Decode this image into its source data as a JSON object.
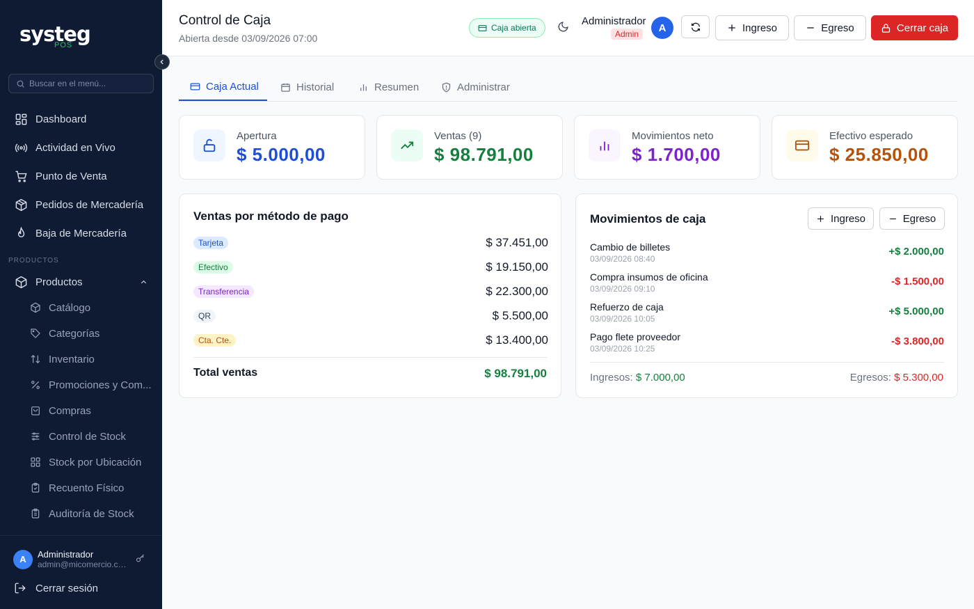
{
  "brand": {
    "name": "systeg",
    "sub": "POS"
  },
  "sidebar": {
    "search_placeholder": "Buscar en el menú...",
    "items": [
      {
        "label": "Dashboard",
        "icon": "dashboard-icon"
      },
      {
        "label": "Actividad en Vivo",
        "icon": "broadcast-icon"
      },
      {
        "label": "Punto de Venta",
        "icon": "cart-icon"
      },
      {
        "label": "Pedidos de Mercadería",
        "icon": "package-icon"
      },
      {
        "label": "Baja de Mercadería",
        "icon": "flame-icon"
      }
    ],
    "section_label": "PRODUCTOS",
    "group": {
      "label": "Productos",
      "icon": "box-icon"
    },
    "subitems": [
      {
        "label": "Catálogo",
        "icon": "box-icon"
      },
      {
        "label": "Categorías",
        "icon": "tag-icon"
      },
      {
        "label": "Inventario",
        "icon": "sort-icon"
      },
      {
        "label": "Promociones y Com...",
        "icon": "percent-icon"
      },
      {
        "label": "Compras",
        "icon": "bag-icon"
      },
      {
        "label": "Control de Stock",
        "icon": "sliders-icon"
      },
      {
        "label": "Stock por Ubicación",
        "icon": "grid-icon"
      },
      {
        "label": "Recuento Físico",
        "icon": "clipboard-icon"
      },
      {
        "label": "Auditoría de Stock",
        "icon": "clipboard-list-icon"
      }
    ],
    "user": {
      "initial": "A",
      "name": "Administrador",
      "email": "admin@micomercio.com"
    },
    "logout_label": "Cerrar sesión"
  },
  "header": {
    "title": "Control de Caja",
    "subtitle": "Abierta desde 03/09/2026 07:00",
    "status_badge": "Caja abierta",
    "user_name": "Administrador",
    "user_role": "Admin",
    "user_initial": "A",
    "btn_ingreso": "Ingreso",
    "btn_egreso": "Egreso",
    "btn_cerrar": "Cerrar caja"
  },
  "tabs": [
    {
      "label": "Caja Actual",
      "active": true
    },
    {
      "label": "Historial",
      "active": false
    },
    {
      "label": "Resumen",
      "active": false
    },
    {
      "label": "Administrar",
      "active": false
    }
  ],
  "stats": [
    {
      "label": "Apertura",
      "value": "$ 5.000,00",
      "color": "#1d4ed8",
      "bg": "#eff6ff"
    },
    {
      "label": "Ventas (9)",
      "value": "$ 98.791,00",
      "color": "#15803d",
      "bg": "#ecfdf5"
    },
    {
      "label": "Movimientos neto",
      "value": "$ 1.700,00",
      "color": "#7e22ce",
      "bg": "#faf5ff"
    },
    {
      "label": "Efectivo esperado",
      "value": "$ 25.850,00",
      "color": "#b45309",
      "bg": "#fffbeb"
    }
  ],
  "payment_methods": {
    "title": "Ventas por método de pago",
    "rows": [
      {
        "method": "Tarjeta",
        "amount": "$ 37.451,00",
        "pill_bg": "#dbeafe",
        "pill_fg": "#1d4ed8"
      },
      {
        "method": "Efectivo",
        "amount": "$ 19.150,00",
        "pill_bg": "#dcfce7",
        "pill_fg": "#15803d"
      },
      {
        "method": "Transferencia",
        "amount": "$ 22.300,00",
        "pill_bg": "#f3e8ff",
        "pill_fg": "#7e22ce"
      },
      {
        "method": "QR",
        "amount": "$ 5.500,00",
        "pill_bg": "#f1f5f9",
        "pill_fg": "#334155"
      },
      {
        "method": "Cta. Cte.",
        "amount": "$ 13.400,00",
        "pill_bg": "#fef3c7",
        "pill_fg": "#b45309"
      }
    ],
    "total_label": "Total ventas",
    "total_value": "$ 98.791,00"
  },
  "movements": {
    "title": "Movimientos de caja",
    "btn_ingreso": "Ingreso",
    "btn_egreso": "Egreso",
    "rows": [
      {
        "name": "Cambio de billetes",
        "time": "03/09/2026 08:40",
        "amount": "+$ 2.000,00",
        "type": "in"
      },
      {
        "name": "Compra insumos de oficina",
        "time": "03/09/2026 09:10",
        "amount": "-$ 1.500,00",
        "type": "out"
      },
      {
        "name": "Refuerzo de caja",
        "time": "03/09/2026 10:05",
        "amount": "+$ 5.000,00",
        "type": "in"
      },
      {
        "name": "Pago flete proveedor",
        "time": "03/09/2026 10:25",
        "amount": "-$ 3.800,00",
        "type": "out"
      }
    ],
    "ingresos_label": "Ingresos:",
    "ingresos_value": "$ 7.000,00",
    "egresos_label": "Egresos:",
    "egresos_value": "$ 5.300,00"
  },
  "colors": {
    "income": "#15803d",
    "expense": "#dc2626",
    "accent": "#1d4ed8",
    "sidebar_bg": "#0f1a33"
  }
}
